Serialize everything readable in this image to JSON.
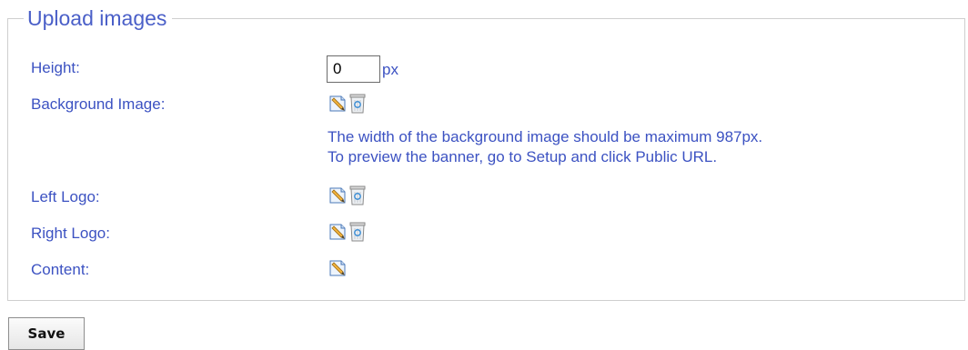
{
  "section": {
    "title": "Upload images"
  },
  "fields": {
    "height": {
      "label": "Height:",
      "value": "0",
      "unit": "px"
    },
    "background_image": {
      "label": "Background Image:",
      "hint_line1": "The width of the background image should be maximum 987px.",
      "hint_line2": "To preview the banner, go to Setup and click Public URL."
    },
    "left_logo": {
      "label": "Left Logo:"
    },
    "right_logo": {
      "label": "Right Logo:"
    },
    "content": {
      "label": "Content:"
    }
  },
  "icons": {
    "edit": "edit-pencil-icon",
    "delete": "recycle-bin-icon"
  },
  "colors": {
    "label_text": "#3c52c2",
    "legend_text": "#4a5fc8",
    "border": "#cfcfcf"
  },
  "actions": {
    "save_label": "Save"
  }
}
